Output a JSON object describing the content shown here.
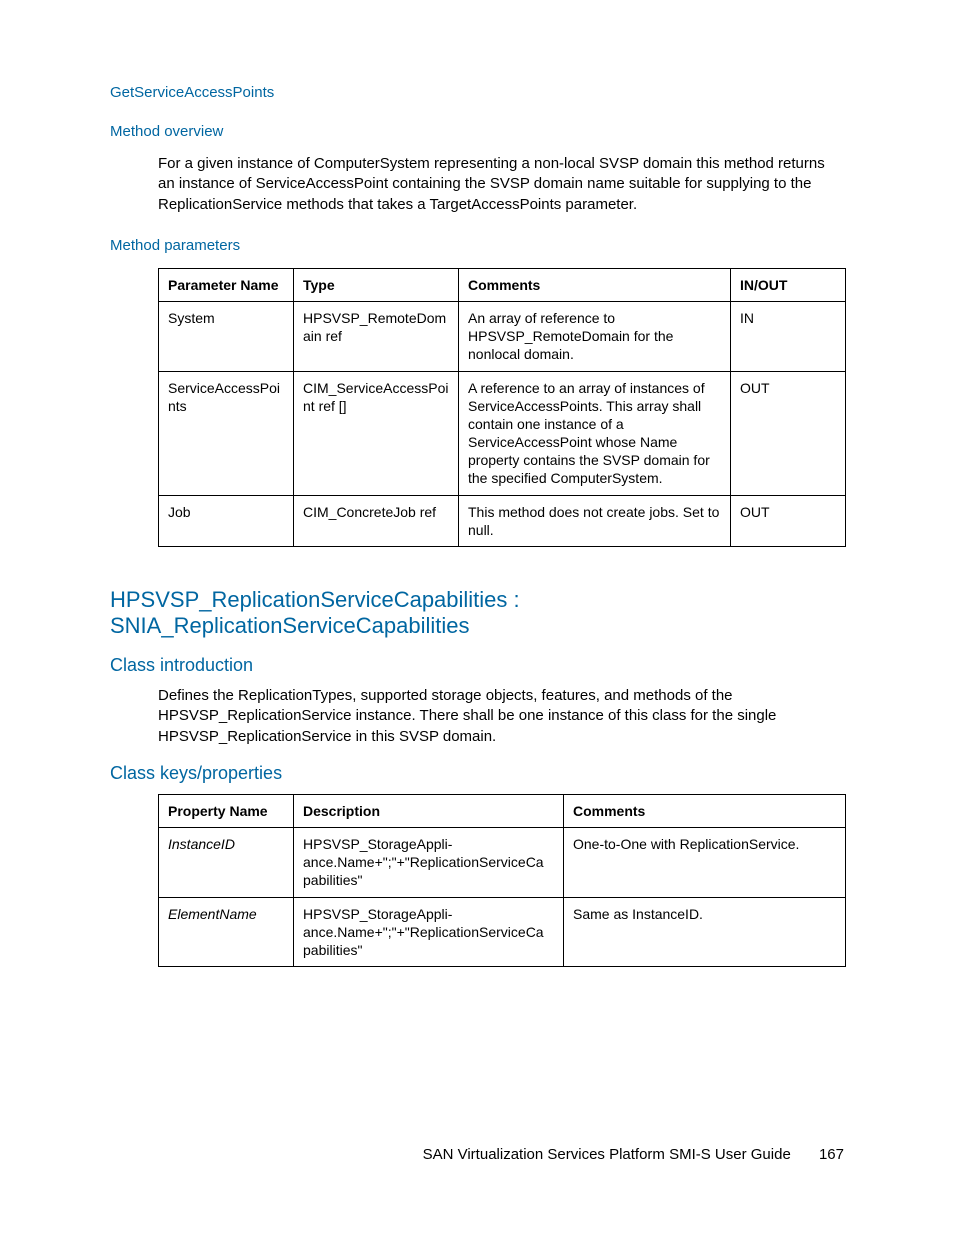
{
  "section1": {
    "title": "GetServiceAccessPoints",
    "overview_label": "Method overview",
    "overview_text": "For a given instance of ComputerSystem representing a non-local SVSP domain this method returns an instance of ServiceAccessPoint containing the SVSP domain name suitable for supplying to the ReplicationService methods that takes a TargetAccessPoints parameter.",
    "params_label": "Method parameters",
    "table": {
      "h1": "Parameter Name",
      "h2": "Type",
      "h3": "Comments",
      "h4": "IN/OUT",
      "rows": [
        {
          "name": "System",
          "type": "HPSVSP_RemoteDomain ref",
          "comments": "An array of reference to HPSVSP_Remote­Domain for the nonlocal domain.",
          "io": "IN"
        },
        {
          "name": "ServiceAccessPoints",
          "type": "CIM_ServiceAccessPoint ref []",
          "comments": "A reference to an array of instances of ServiceAccessPoints. This array shall contain one instance of a ServiceAccessPoint whose Name property contains the SVSP domain for the specified ComputerSystem.",
          "io": "OUT"
        },
        {
          "name": "Job",
          "type": "CIM_ConcreteJob ref",
          "comments": "This method does not create jobs. Set to null.",
          "io": "OUT"
        }
      ]
    }
  },
  "section2": {
    "title": "HPSVSP_ReplicationServiceCapabilities : SNIA_ReplicationServiceCapabilities",
    "intro_label": "Class introduction",
    "intro_text": "Defines the ReplicationTypes, supported storage objects, features, and methods of the HPSVSP_ReplicationService instance. There shall be one instance of this class for the single HPSVSP_ReplicationService in this SVSP domain.",
    "keys_label": "Class keys/properties",
    "table": {
      "h1": "Property Name",
      "h2": "Description",
      "h3": "Comments",
      "rows": [
        {
          "name": "InstanceID",
          "desc": "HPSVSP_StorageAppli­ance.Name+\";\"+\"ReplicationServiceCap­abilities\"",
          "comments": "One-to-One with ReplicationService."
        },
        {
          "name": "ElementName",
          "desc": "HPSVSP_StorageAppli­ance.Name+\";\"+\"ReplicationServiceCap­abilities\"",
          "comments": "Same as InstanceID."
        }
      ]
    }
  },
  "footer": {
    "title": "SAN Virtualization Services Platform SMI-S User Guide",
    "page": "167"
  }
}
